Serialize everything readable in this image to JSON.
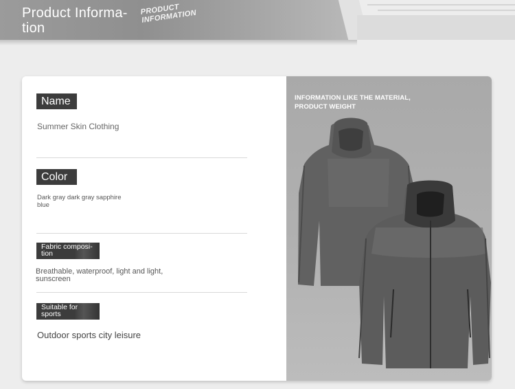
{
  "banner": {
    "title": "Product Informa-\ntion",
    "subtitle_line1": "PRODUCT",
    "subtitle_line2": "INFORMATION"
  },
  "fields": {
    "name": {
      "label": "Name",
      "value": "Summer Skin Clothing"
    },
    "color": {
      "label": "Color",
      "value": "Dark gray dark gray sapphire\nblue"
    },
    "fabric": {
      "label": "Fabric composi-\ntion",
      "value": "Breathable, waterproof, light and light,\nsunscreen"
    },
    "suitable": {
      "label": "Suitable for\nsports",
      "value": "Outdoor sports city leisure"
    }
  },
  "image_panel": {
    "caption": "INFORMATION LIKE THE MATERIAL,\nPRODUCT WEIGHT"
  }
}
